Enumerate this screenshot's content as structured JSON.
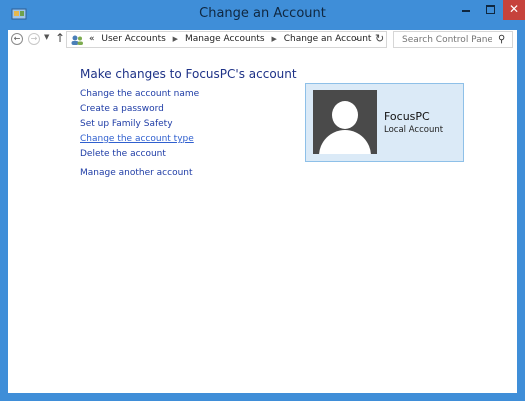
{
  "window": {
    "title": "Change an Account",
    "close_glyph": "✕",
    "icon": "control-panel-icon"
  },
  "toolbar": {
    "back_glyph": "←",
    "forward_glyph": "→",
    "recent_glyph": "▼",
    "up_glyph": "↑",
    "address_icon": "user-accounts-icon",
    "overflow": "«",
    "breadcrumbs": [
      "User Accounts",
      "Manage Accounts",
      "Change an Account"
    ],
    "separator": "▶",
    "dropdown_glyph": "⌄",
    "refresh_glyph": "↻",
    "search_placeholder": "Search Control Panel",
    "search_glyph": "⚲"
  },
  "main": {
    "heading": "Make changes to FocusPC's account",
    "links": [
      "Change the account name",
      "Create a password",
      "Set up Family Safety",
      "Change the account type",
      "Delete the account"
    ],
    "manage_other": "Manage another account"
  },
  "account": {
    "name": "FocusPC",
    "type": "Local Account"
  },
  "colors": {
    "frame": "#3f8ed8",
    "link": "#1e3ca6",
    "heading": "#1e3287",
    "card_bg": "#dbeaf7",
    "close": "#c6423c"
  }
}
